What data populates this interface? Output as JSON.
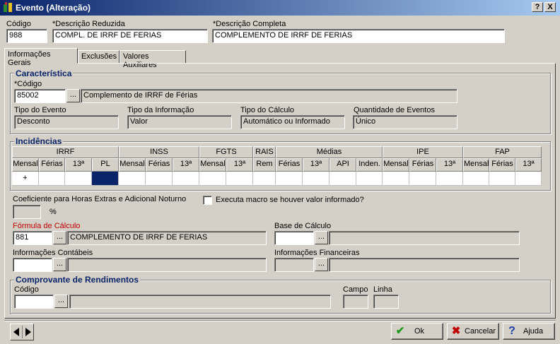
{
  "window": {
    "title": "Evento (Alteração)",
    "help_btn": "?",
    "close_btn": "X"
  },
  "header": {
    "codigo_label": "Código",
    "codigo_value": "988",
    "desc_red_label": "*Descrição Reduzida",
    "desc_red_value": "COMPL. DE IRRF DE FERIAS",
    "desc_comp_label": "*Descrição Completa",
    "desc_comp_value": "COMPLEMENTO DE IRRF DE FERIAS"
  },
  "tabs": [
    "Informações Gerais",
    "Exclusões",
    "Valores Auxiliares"
  ],
  "caracteristica": {
    "title": "Característica",
    "codigo_label": "*Código",
    "codigo_value": "85002",
    "codigo_desc": "Complemento de IRRF de Férias",
    "tipo_evento_label": "Tipo do Evento",
    "tipo_evento_value": "Desconto",
    "tipo_info_label": "Tipo da Informação",
    "tipo_info_value": "Valor",
    "tipo_calc_label": "Tipo do Cálculo",
    "tipo_calc_value": "Automático ou Informado",
    "qtd_label": "Quantidade de Eventos",
    "qtd_value": "Único"
  },
  "incidencias": {
    "title": "Incidências",
    "groups": [
      "IRRF",
      "INSS",
      "FGTS",
      "RAIS",
      "Médias",
      "IPE",
      "FAP"
    ],
    "columns": [
      "Mensal",
      "Férias",
      "13ª",
      "PL",
      "Mensal",
      "Férias",
      "13ª",
      "Mensal",
      "13ª",
      "Rem",
      "Férias",
      "13ª",
      "API",
      "Inden.",
      "Mensal",
      "Férias",
      "13ª",
      "Mensal",
      "Férias",
      "13ª"
    ],
    "row": [
      "+",
      "",
      "",
      "",
      "",
      "",
      "",
      "",
      "",
      "",
      "",
      "",
      "",
      "",
      "",
      "",
      "",
      "",
      "",
      ""
    ]
  },
  "coef": {
    "label": "Coeficiente para Horas Extras e Adicional Noturno",
    "percent": "%",
    "macro_label": "Executa macro se houver valor informado?"
  },
  "formula": {
    "label": "Fórmula de Cálculo",
    "value": "881",
    "desc": "COMPLEMENTO DE IRRF DE FERIAS"
  },
  "base": {
    "label": "Base de Cálculo"
  },
  "contabeis": {
    "label": "Informações Contábeis"
  },
  "financeiras": {
    "label": "Informações Financeiras"
  },
  "comprovante": {
    "title": "Comprovante de Rendimentos",
    "codigo_label": "Código",
    "campo_label": "Campo",
    "linha_label": "Linha"
  },
  "buttons": {
    "ok": "Ok",
    "cancel": "Cancelar",
    "help": "Ajuda",
    "ellipsis": "..."
  }
}
